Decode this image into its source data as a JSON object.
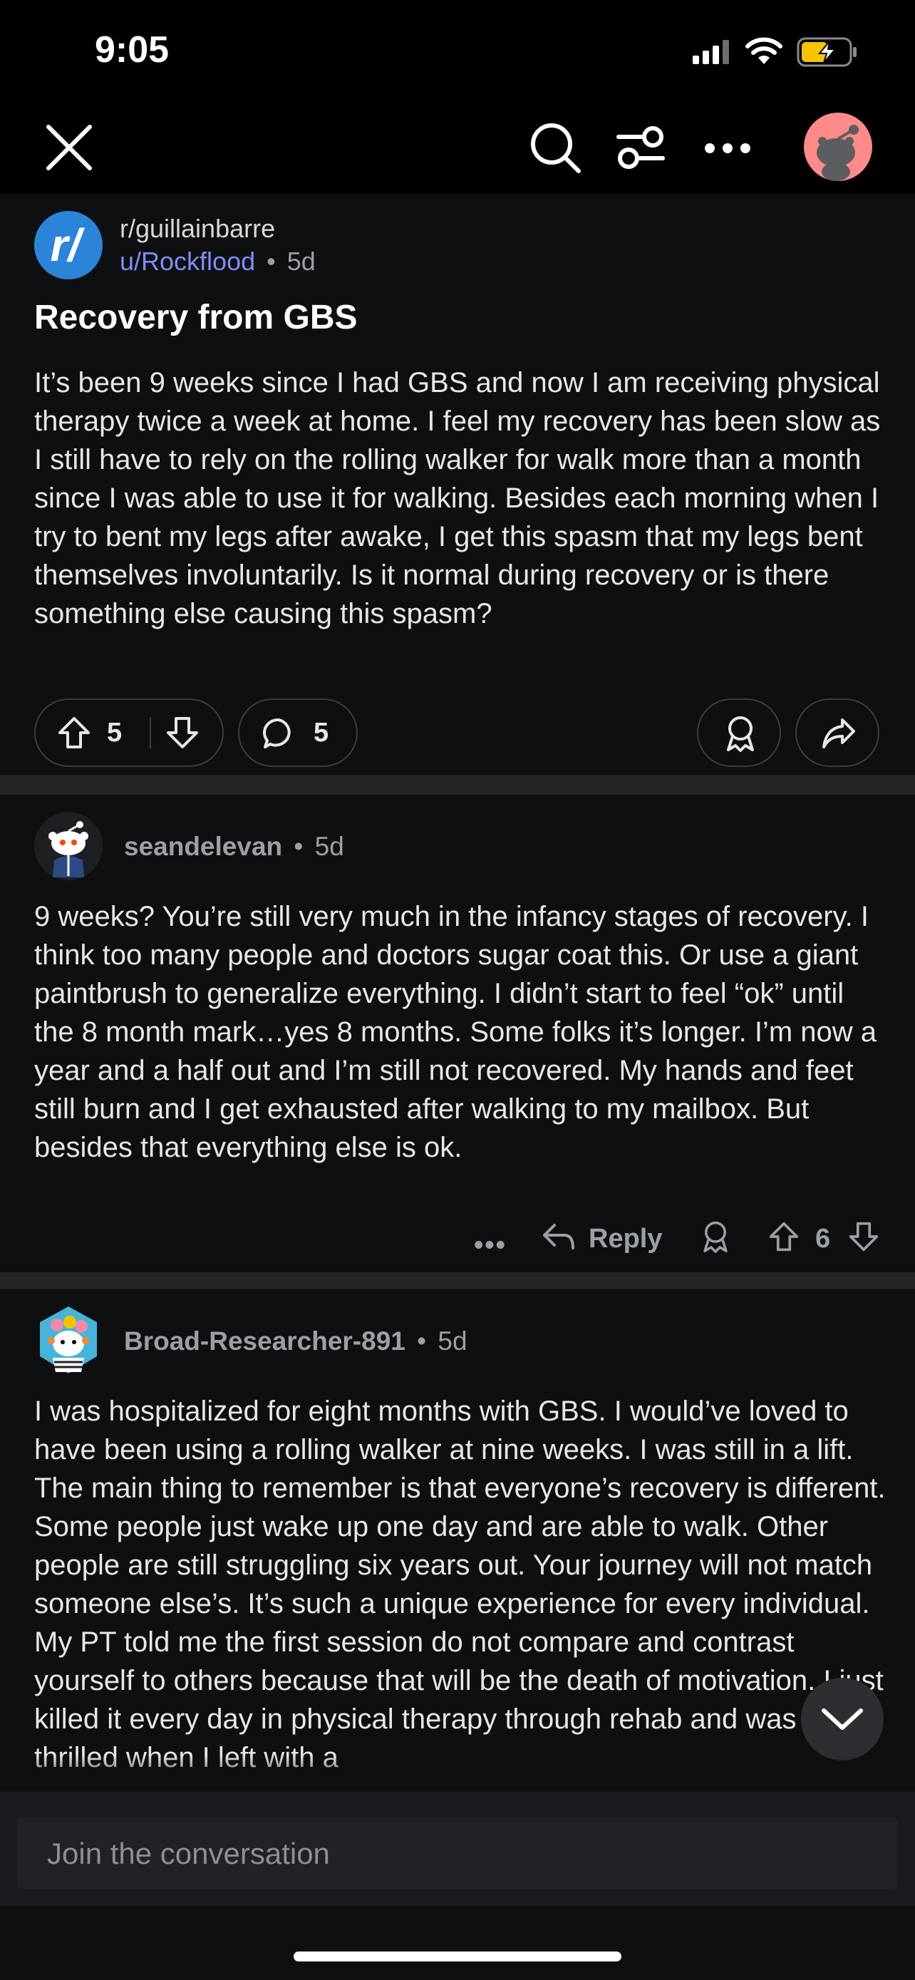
{
  "status_bar": {
    "time": "9:05",
    "icons": [
      "signal-icon",
      "wifi-icon",
      "battery-charging-icon"
    ],
    "battery_color": "#f5c400"
  },
  "top_bar": {
    "icons": [
      "close-icon",
      "search-icon",
      "sort-icon",
      "more-icon",
      "avatar"
    ]
  },
  "post": {
    "subreddit": "r/guillainbarre",
    "author": "u/Rockflood",
    "separator": "•",
    "age": "5d",
    "title": "Recovery from GBS",
    "body": "It’s been 9 weeks since I had GBS and now I am receiving physical therapy twice a week at home. I feel my recovery has been slow as I still have to rely on the rolling walker for walk more than a month since I was able to use it for walking. Besides each morning when I try to bent my legs after awake, I get this spasm that my legs bent themselves involuntarily. Is it normal during recovery or is there something else causing this spasm?",
    "upvotes": "5",
    "comments": "5"
  },
  "comments": [
    {
      "author": "seandelevan",
      "separator": "•",
      "age": "5d",
      "body": "9 weeks? You’re still very much in the infancy stages of recovery. I think too many people and doctors sugar coat this. Or use a giant paintbrush to generalize everything. I didn’t start to feel “ok” until the 8 month mark…yes 8 months. Some folks it’s longer. I’m now a year and a half out and I’m still not recovered. My hands and feet still burn and I get exhausted after walking to my mailbox. But besides that everything else is ok.",
      "more": "•••",
      "reply_label": "Reply",
      "score": "6"
    },
    {
      "author": "Broad-Researcher-891",
      "separator": "•",
      "age": "5d",
      "body": "I was hospitalized for eight months with GBS. I would’ve loved to have been using a rolling walker at nine weeks. I was still in a lift. The main thing to remember is that everyone’s recovery is different. Some people just wake up one day and are able to walk. Other people are still struggling six years out. Your journey will not match someone else’s. It’s such a unique experience for every individual. My PT told me the first session do not compare and contrast yourself to others because that will be the death of motivation. I just killed it every day in physical therapy through rehab and was thrilled when I left with a"
    }
  ],
  "composer": {
    "placeholder": "Join the conversation"
  },
  "colors": {
    "background": "#0e0f11",
    "link": "#7f8ef5",
    "subreddit_icon": "#2b84d8",
    "avatar": "#ff8a8a"
  }
}
